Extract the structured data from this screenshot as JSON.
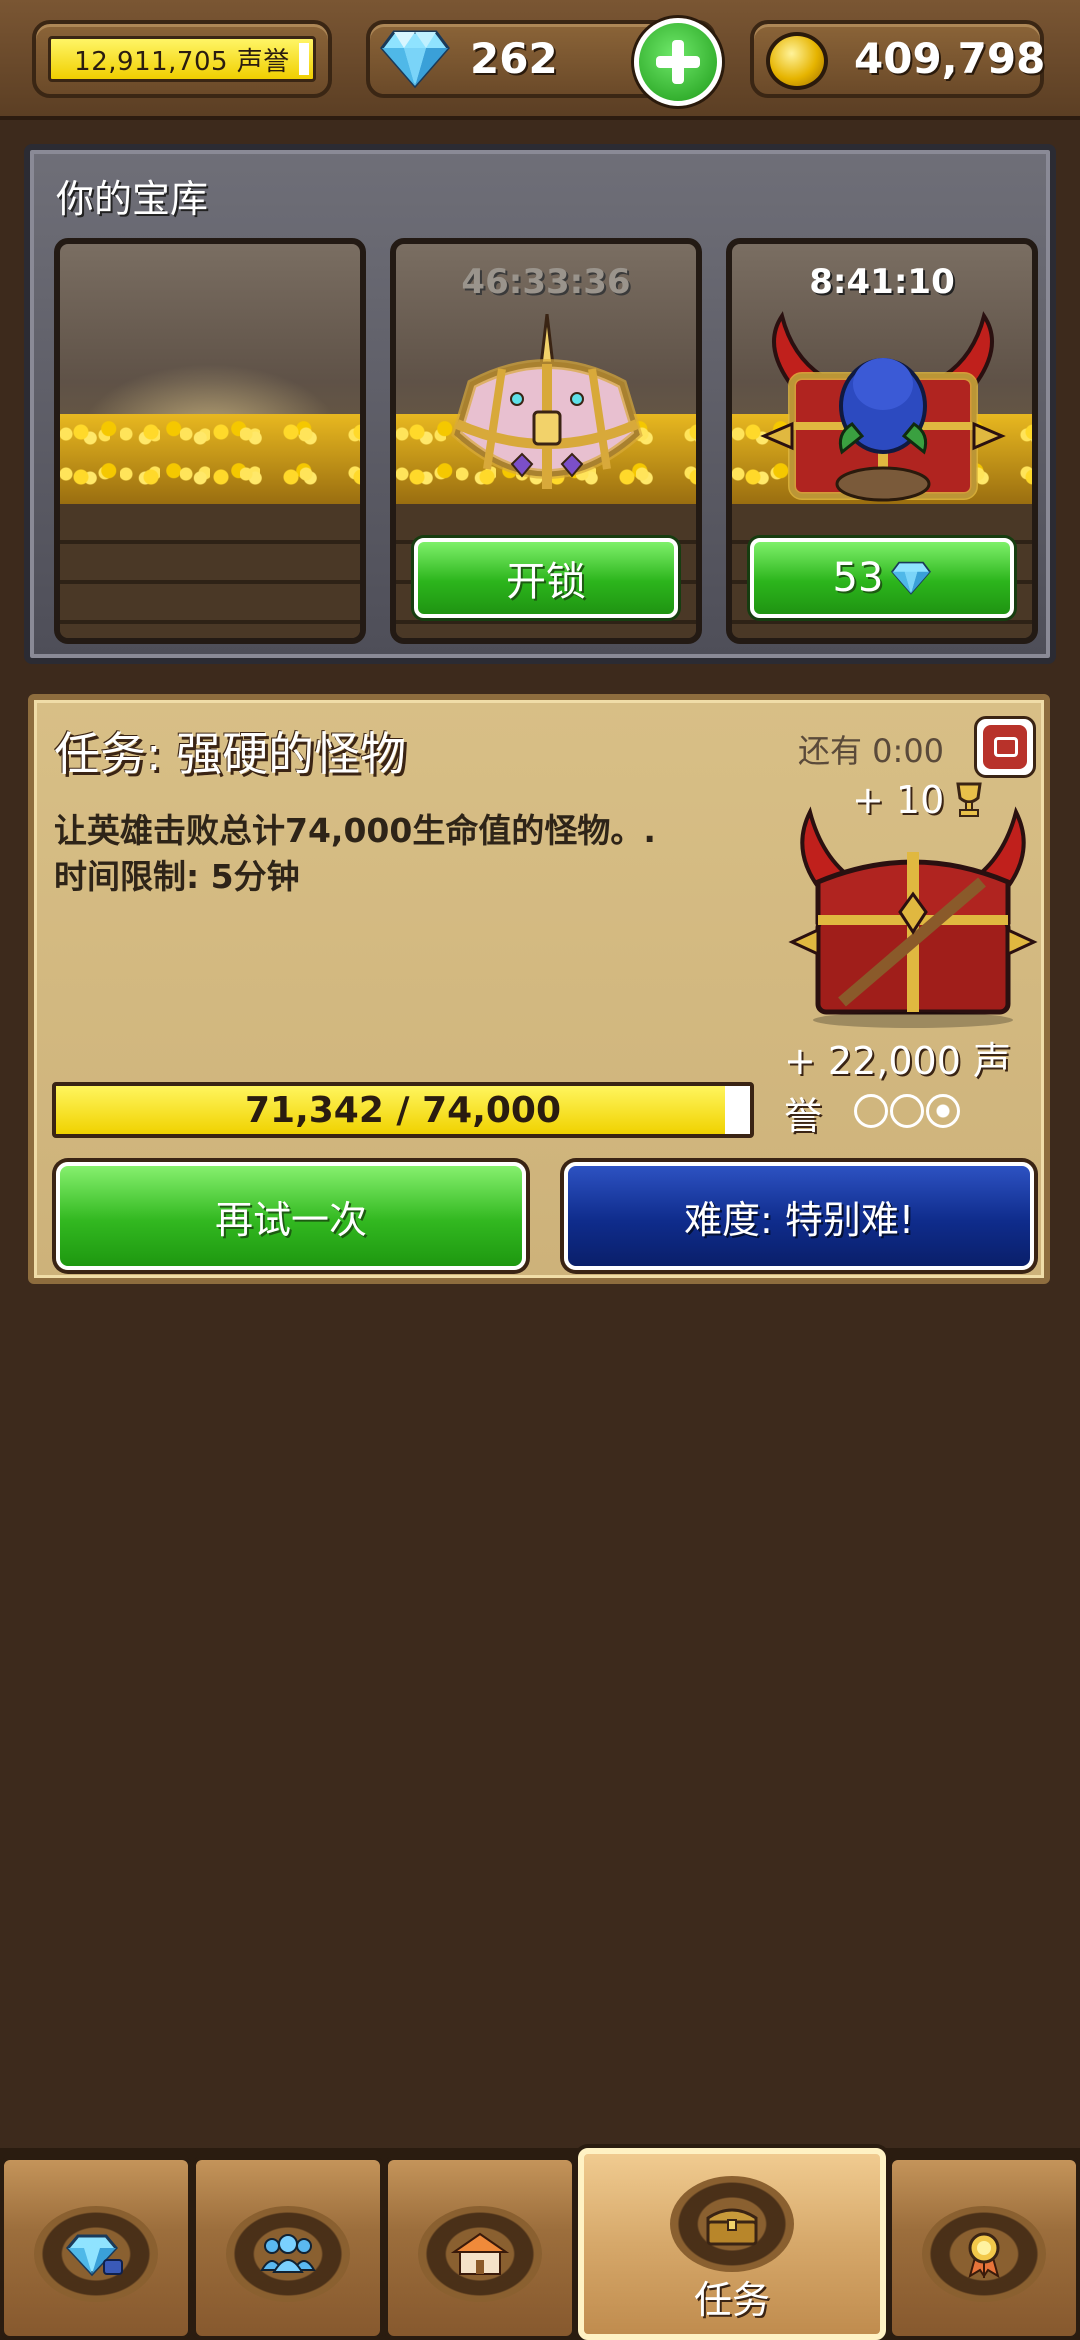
{
  "topbar": {
    "fame": "12,911,705 声誉",
    "gems": "262",
    "gold": "409,798"
  },
  "vault": {
    "title": "你的宝库",
    "slots": [
      {
        "timer": "",
        "button": ""
      },
      {
        "timer": "46:33:36",
        "button": "开锁"
      },
      {
        "timer": "8:41:10",
        "button": "53"
      }
    ]
  },
  "quest": {
    "title": "任务: 强硬的怪物",
    "remaining": "还有 0:00",
    "description_line1": "让英雄击败总计74,000生命值的怪物。.",
    "description_line2": "时间限制: 5分钟",
    "trophy_reward": "+ 10",
    "fame_reward": "+ 22,000 声誉",
    "progress_text": "71,342 / 74,000",
    "progress_value": 71342,
    "progress_max": 74000,
    "stars_earned": 1,
    "stars_total": 3,
    "retry_button": "再试一次",
    "difficulty_button": "难度: 特别难!"
  },
  "nav": {
    "tabs": [
      {
        "icon": "gem-shop-icon",
        "label": ""
      },
      {
        "icon": "heroes-icon",
        "label": ""
      },
      {
        "icon": "town-icon",
        "label": ""
      },
      {
        "icon": "chest-icon",
        "label": "任务"
      },
      {
        "icon": "medal-icon",
        "label": ""
      }
    ],
    "active_index": 3
  },
  "colors": {
    "progress_fill": "#f0d200",
    "retry_green": "#32b820",
    "difficulty_blue": "#0f2c8c",
    "background": "#3d2a1c"
  }
}
